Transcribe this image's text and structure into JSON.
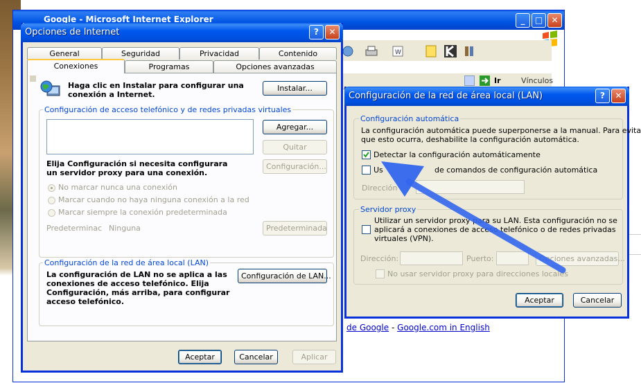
{
  "browser": {
    "title": "Google - Microsoft Internet Explorer",
    "go_label": "Ir",
    "links_label": "Vínculos",
    "google_links": [
      "de Google",
      "Google.com in English"
    ],
    "separator": "-"
  },
  "internet_options": {
    "title": "Opciones de Internet",
    "help_glyph": "?",
    "close_glyph": "✕",
    "tabs_row1": [
      "General",
      "Seguridad",
      "Privacidad",
      "Contenido"
    ],
    "tabs_row2": [
      "Conexiones",
      "Programas",
      "Opciones avanzadas"
    ],
    "setup_text_1": "Haga clic en Instalar para configurar una",
    "setup_text_2": "conexión a Internet.",
    "install_button": "Instalar...",
    "dialup_group_title": "Configuración de acceso telefónico y de redes privadas virtuales",
    "add_button": "Agregar...",
    "remove_button": "Quitar",
    "settings_button": "Configuración...",
    "proxy_text_1": "Elija Configuración si necesita configurara",
    "proxy_text_2": "un servidor proxy para una conexión.",
    "radio_options": [
      "No marcar nunca una conexión",
      "Marcar cuando no haya ninguna conexión a la red",
      "Marcar siempre la conexión predeterminada"
    ],
    "default_label": "Predeterminac",
    "default_value": "Ninguna",
    "default_button": "Predeterminada",
    "lan_group_title": "Configuración de la red de área local (LAN)",
    "lan_text": [
      "La configuración de LAN no se aplica a las",
      "conexiones de acceso telefónico. Elija",
      "Configuración, más arriba, para configurar",
      "acceso telefónico."
    ],
    "lan_button": "Configuración de LAN...",
    "ok_button": "Aceptar",
    "cancel_button": "Cancelar",
    "apply_button": "Aplicar"
  },
  "lan_settings": {
    "title": "Configuración de la red de área local (LAN)",
    "help_glyph": "?",
    "close_glyph": "✕",
    "auto_group_title": "Configuración automática",
    "auto_text_1": "La configuración automática puede superponerse a la manual. Para evitar",
    "auto_text_2": "que esto ocurra, deshabilite la configuración automática.",
    "auto_detect_label": "Detectar la configuración automáticamente",
    "auto_detect_checked": true,
    "script_label_start": "Us",
    "script_label_end": "de comandos de configuración automática",
    "address_label": "Dirección",
    "proxy_group_title": "Servidor proxy",
    "proxy_text": [
      "Utilizar un servidor proxy para su LAN. Esta configuración no se",
      "aplicará a conexiones de acceso telefónico o de redes privadas",
      "virtuales (VPN)."
    ],
    "proxy_address_label": "Dirección:",
    "proxy_port_label": "Puerto:",
    "advanced_button": "Opciones avanzadas...",
    "bypass_label": "No usar servidor proxy para direcciones locales",
    "ok_button": "Aceptar",
    "cancel_button": "Cancelar"
  },
  "colors": {
    "xp_blue": "#0054e3",
    "dialog_face": "#ece9d8",
    "group_title": "#0046d5",
    "arrow": "#3366ee"
  }
}
